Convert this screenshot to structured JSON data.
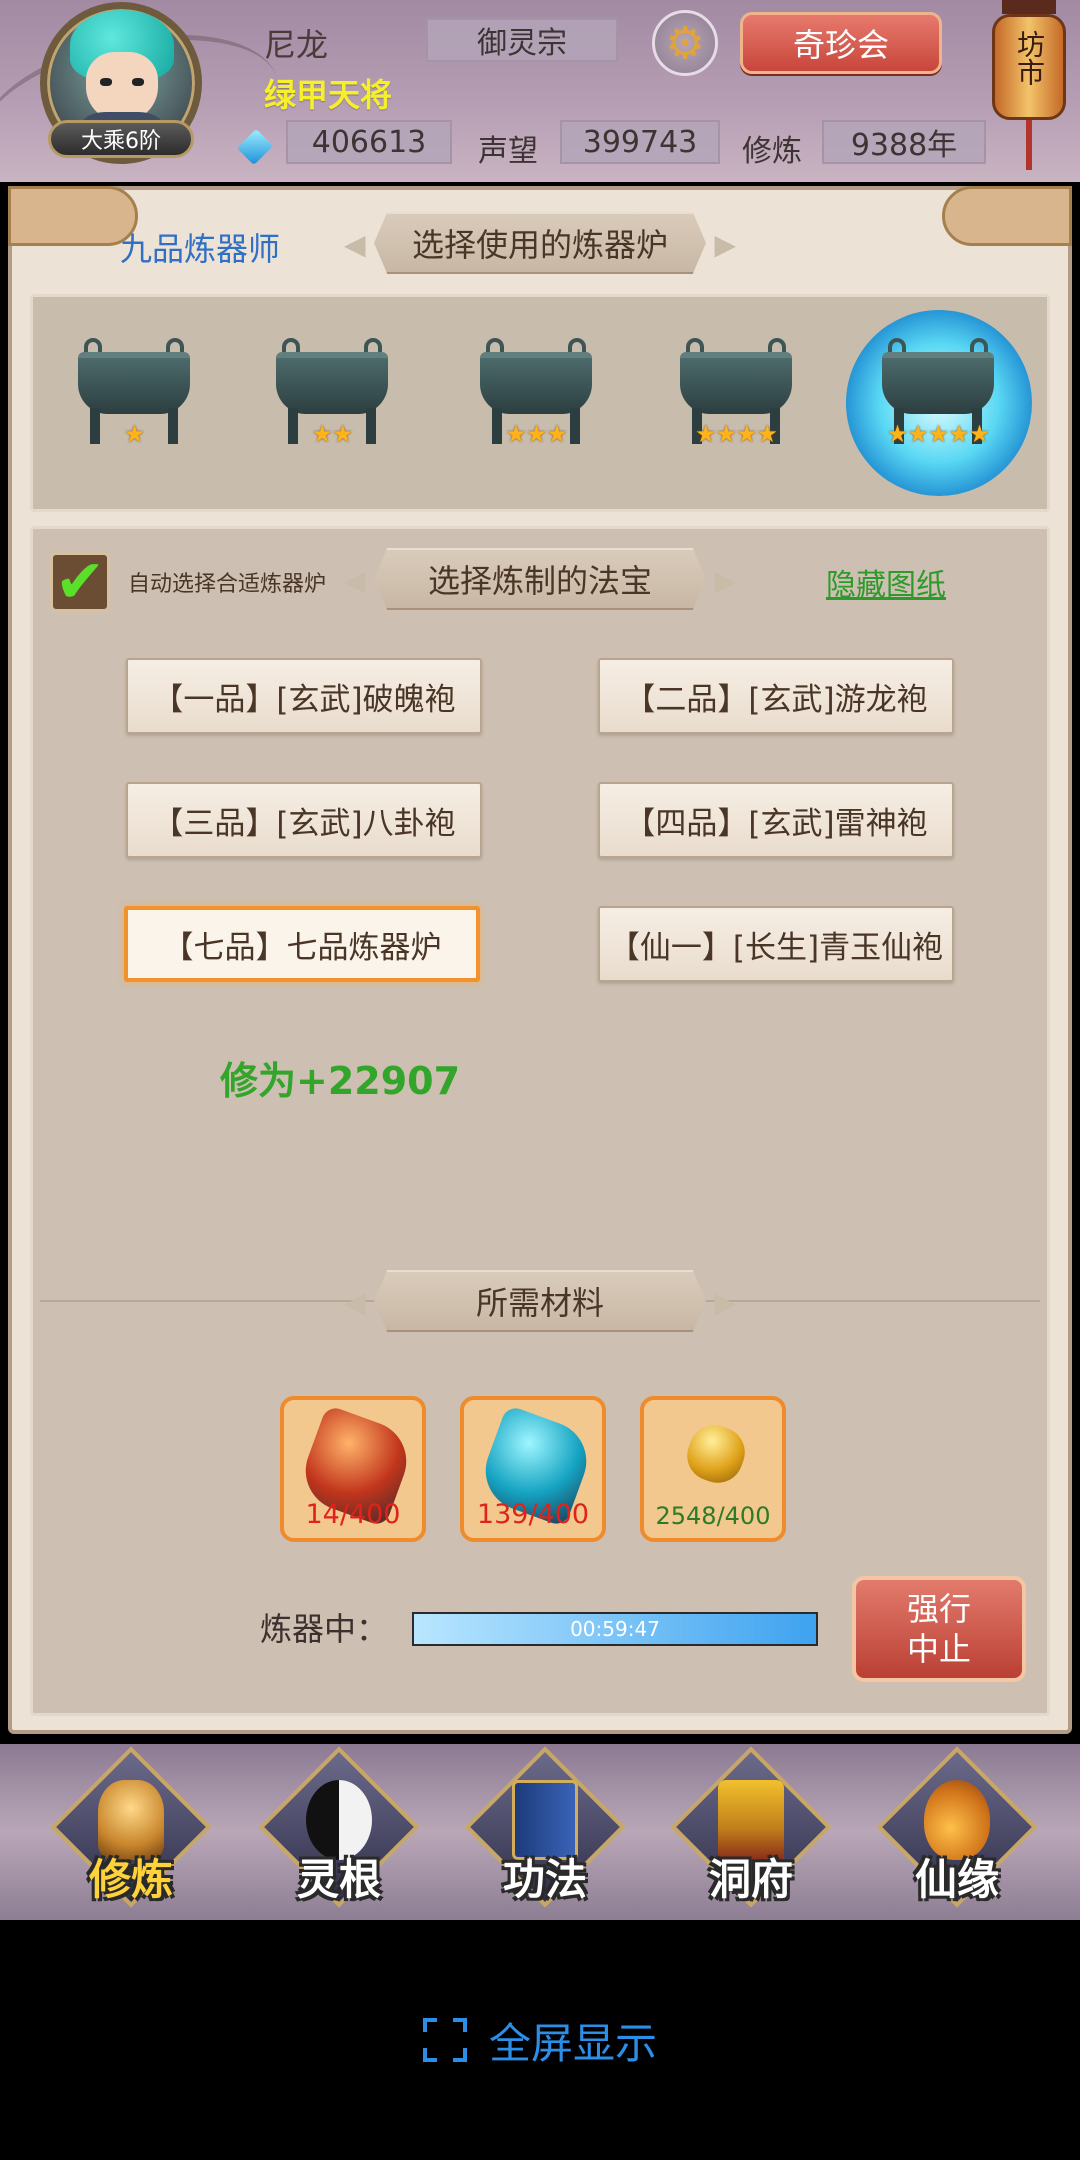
{
  "header": {
    "player_name": "尼龙",
    "player_title": "绿甲天将",
    "level_badge": "大乘6阶",
    "sect": "御灵宗",
    "treasure_button": "奇珍会",
    "market_lantern": "坊市",
    "spirit_stones": "406613",
    "prestige_label": "声望",
    "prestige": "399743",
    "cultivation_label": "修炼",
    "cultivation": "9388年"
  },
  "furnace_section": {
    "refiner_rank": "九品炼器师",
    "title": "选择使用的炼器炉",
    "furnaces": [
      {
        "stars": "★",
        "star_count": 1
      },
      {
        "stars": "★★",
        "star_count": 2
      },
      {
        "stars": "★★★",
        "star_count": 3
      },
      {
        "stars": "★★★★",
        "star_count": 4
      },
      {
        "stars": "★★★★★",
        "star_count": 5,
        "selected": true
      }
    ]
  },
  "item_section": {
    "title": "选择炼制的法宝",
    "auto_select_label": "自动选择合适炼器炉",
    "auto_select_checked": true,
    "hide_blueprints": "隐藏图纸",
    "recipes": [
      {
        "label": "【一品】[玄武]破魄袍"
      },
      {
        "label": "【二品】[玄武]游龙袍"
      },
      {
        "label": "【三品】[玄武]八卦袍"
      },
      {
        "label": "【四品】[玄武]雷神袍"
      },
      {
        "label": "【七品】七品炼器炉",
        "selected": true
      },
      {
        "label": "【仙一】[长生]青玉仙袍"
      }
    ],
    "exp_gain": "修为+22907"
  },
  "materials": {
    "title": "所需材料",
    "items": [
      {
        "count": "14/400",
        "color": "#e0231a"
      },
      {
        "count": "139/400",
        "color": "#e0231a"
      },
      {
        "count": "2548/400",
        "color": "#2c7b27"
      }
    ]
  },
  "refining": {
    "label": "炼器中：",
    "timer": "00:59:47",
    "progress": 1.0,
    "abort_button": "强行中止"
  },
  "nav": {
    "items": [
      {
        "label": "修炼",
        "icon": "meditating-monk-icon",
        "active": true
      },
      {
        "label": "灵根",
        "icon": "yin-yang-sword-icon"
      },
      {
        "label": "功法",
        "icon": "scroll-book-icon"
      },
      {
        "label": "洞府",
        "icon": "pagoda-icon"
      },
      {
        "label": "仙缘",
        "icon": "gourd-icon"
      }
    ]
  },
  "fullscreen_label": "全屏显示"
}
